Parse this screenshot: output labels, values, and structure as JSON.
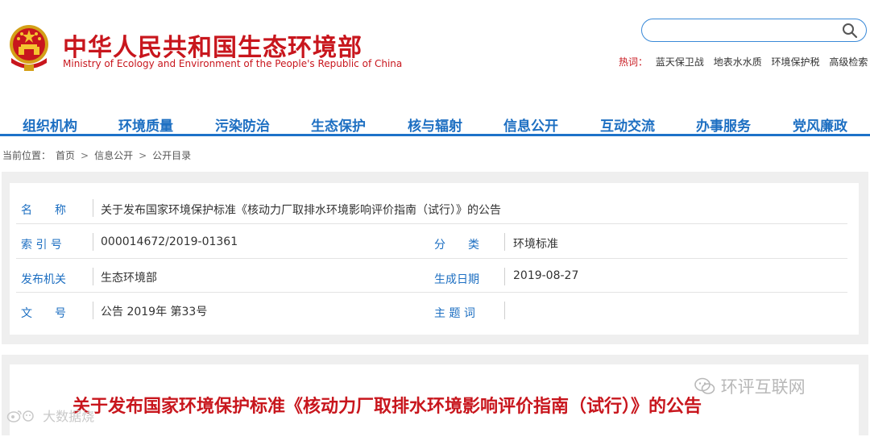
{
  "header": {
    "title_cn": "中华人民共和国生态环境部",
    "title_en": "Ministry of Ecology and Environment of the People's Republic of China",
    "search_value": "",
    "hot_label": "热词：",
    "hot_words": [
      "蓝天保卫战",
      "地表水水质",
      "环境保护税",
      "高级检索"
    ]
  },
  "nav": [
    "组织机构",
    "环境质量",
    "污染防治",
    "生态保护",
    "核与辐射",
    "信息公开",
    "互动交流",
    "办事服务",
    "党风廉政"
  ],
  "breadcrumb": {
    "prefix": "当前位置：",
    "items": [
      "首页",
      "信息公开",
      "公开目录"
    ],
    "separator": ">"
  },
  "info": {
    "name_label": "名　　称",
    "name_value": "关于发布国家环境保护标准《核动力厂取排水环境影响评价指南（试行）》的公告",
    "index_label": "索 引 号",
    "index_value": "000014672/2019-01361",
    "category_label": "分　　类",
    "category_value": "环境标准",
    "issuer_label": "发布机关",
    "issuer_value": "生态环境部",
    "date_label": "生成日期",
    "date_value": "2019-08-27",
    "doc_no_label": "文　　号",
    "doc_no_value": "公告 2019年 第33号",
    "subject_label": "主 题 词",
    "subject_value": ""
  },
  "article": {
    "title": "关于发布国家环境保护标准《核动力厂取排水环境影响评价指南（试行）》的公告"
  },
  "watermarks": {
    "right": "环评互联网",
    "left": "大数据烧"
  },
  "colors": {
    "brand_red": "#c8161d",
    "nav_blue": "#1d6fc2",
    "panel_gray": "#efefef"
  }
}
